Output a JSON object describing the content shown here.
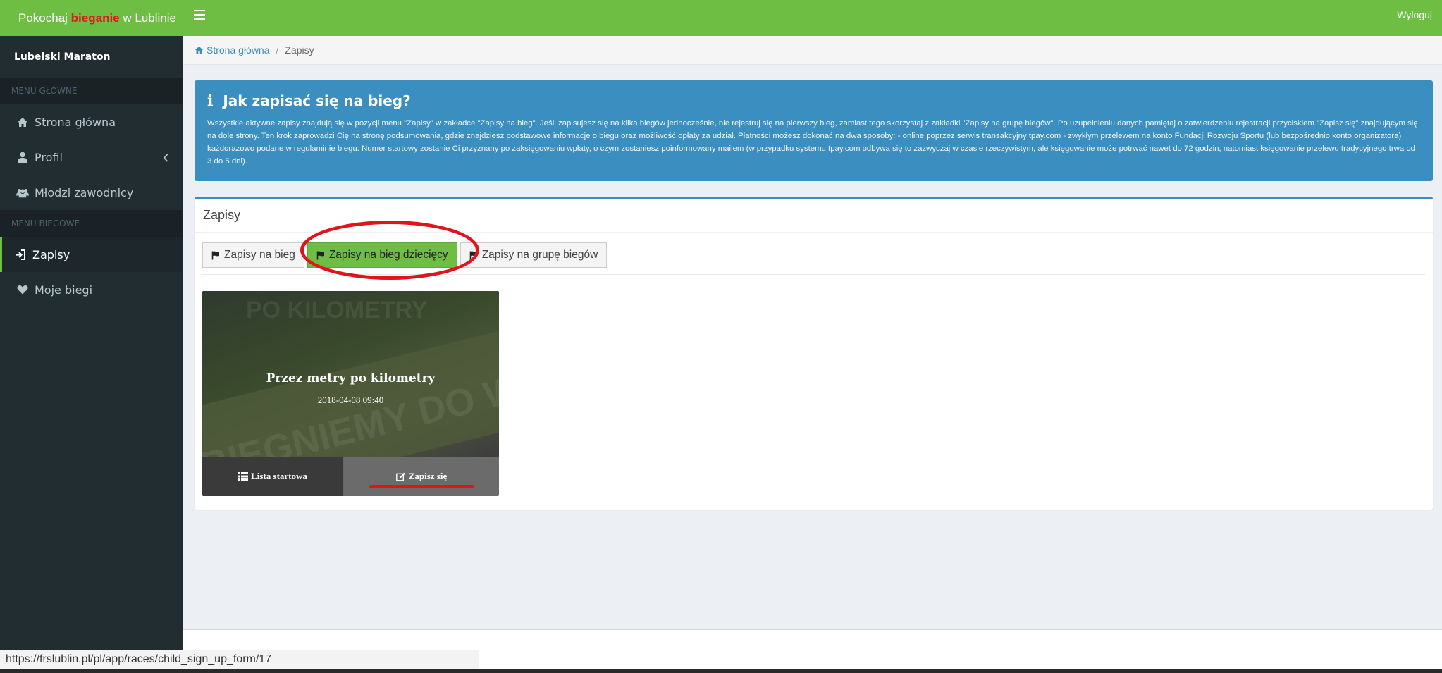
{
  "header": {
    "logo_pre": "Pokochaj ",
    "logo_highlight": "bieganie",
    "logo_post": " w Lublinie",
    "logout_label": "Wyloguj"
  },
  "sidebar": {
    "user_name": "Lubelski Maraton",
    "section_main": "MENU GŁÓWNE",
    "section_running": "MENU BIEGOWE",
    "items": [
      {
        "label": "Strona główna",
        "icon": "home-icon"
      },
      {
        "label": "Profil",
        "icon": "user-icon"
      },
      {
        "label": "Młodzi zawodnicy",
        "icon": "users-icon"
      },
      {
        "label": "Zapisy",
        "icon": "sign-in-icon"
      },
      {
        "label": "Moje biegi",
        "icon": "heart-icon"
      }
    ]
  },
  "breadcrumb": {
    "home": "Strona główna",
    "current": "Zapisy"
  },
  "callout": {
    "title": "Jak zapisać się na bieg?",
    "text": "Wszystkie aktywne zapisy znajdują się w pozycji menu \"Zapisy\" w zakładce \"Zapisy na bieg\". Jeśli zapisujesz się na kilka biegów jednocześnie, nie rejestruj się na pierwszy bieg, zamiast tego skorzystaj z zakładki \"Zapisy na grupę biegów\". Po uzupełnieniu danych pamiętaj o zatwierdzeniu rejestracji przyciskiem \"Zapisz się\" znajdującym się na dole strony. Ten krok zaprowadzi Cię na stronę podsumowania, gdzie znajdziesz podstawowe informacje o biegu oraz możliwość opłaty za udział. Płatności możesz dokonać na dwa sposoby: - online poprzez serwis transakcyjny tpay.com - zwykłym przelewem na konto Fundacji Rozwoju Sportu (lub bezpośrednio konto organizatora) każdorazowo podane w regulaminie biegu. Numer startowy zostanie Ci przyznany po zaksięgowaniu wpłaty, o czym zostaniesz poinformowany mailem (w przypadku systemu tpay.com odbywa się to zazwyczaj w czasie rzeczywistym, ale księgowanie może potrwać nawet do 72 godzin, natomiast księgowanie przelewu tradycyjnego trwa od 3 do 5 dni)."
  },
  "box": {
    "title": "Zapisy",
    "tabs": [
      {
        "label": "Zapisy na bieg",
        "active": false
      },
      {
        "label": "Zapisy na bieg dziecięcy",
        "active": true
      },
      {
        "label": "Zapisy na grupę biegów",
        "active": false
      }
    ]
  },
  "race_card": {
    "title": "Przez metry po kilometry",
    "date": "2018-04-08 09:40",
    "list_button": "Lista startowa",
    "signup_button": "Zapisz się"
  },
  "statusbar": {
    "url": "https://frslublin.pl/pl/app/races/child_sign_up_form/17"
  },
  "colors": {
    "brand_green": "#6fbe44",
    "sidebar_bg": "#222d32",
    "callout_blue": "#3b8ec0",
    "annotation_red": "#e0141c"
  }
}
